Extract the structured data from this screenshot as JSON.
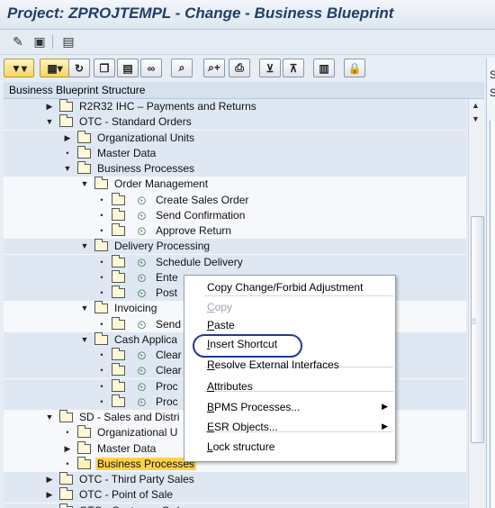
{
  "window": {
    "title": "Project: ZPROJTEMPL - Change - Business Blueprint"
  },
  "toolbar1": [
    {
      "icon": "pencil-glasses-icon",
      "glyph": "✎"
    },
    {
      "icon": "display-other-icon",
      "glyph": "▣"
    },
    {
      "icon": "grid-icon",
      "glyph": "▤"
    }
  ],
  "toolbar2": [
    {
      "icon": "filter-dropdown-icon",
      "glyph": "▼▾"
    },
    {
      "icon": "table-dropdown-icon",
      "glyph": "▦▾"
    },
    {
      "icon": "refresh-icon",
      "glyph": "↻"
    },
    {
      "icon": "copy-icon",
      "glyph": "❐"
    },
    {
      "icon": "paste-icon",
      "glyph": "▤"
    },
    {
      "icon": "link-icon",
      "glyph": "∞"
    },
    {
      "icon": "find-icon",
      "glyph": "⌕"
    },
    {
      "icon": "find-next-icon",
      "glyph": "⌕+"
    },
    {
      "icon": "print-icon",
      "glyph": "⎙"
    },
    {
      "icon": "collapse-icon",
      "glyph": "⊻"
    },
    {
      "icon": "expand-icon",
      "glyph": "⊼"
    },
    {
      "icon": "details-icon",
      "glyph": "▥"
    },
    {
      "icon": "lock-icon",
      "glyph": "🔒"
    }
  ],
  "tree": {
    "header": "Business Blueprint Structure",
    "rows": [
      {
        "label": "R2R32 IHC – Payments and Returns",
        "level": 2,
        "expander": "collapsed",
        "icon": "folder",
        "band": true
      },
      {
        "label": "OTC - Standard Orders",
        "level": 2,
        "expander": "expanded",
        "icon": "folder",
        "band": true
      },
      {
        "label": "Organizational Units",
        "level": 3,
        "expander": "collapsed",
        "icon": "folder",
        "band": true
      },
      {
        "label": "Master Data",
        "level": 3,
        "expander": "leaf",
        "icon": "folder",
        "band": true
      },
      {
        "label": "Business Processes",
        "level": 3,
        "expander": "expanded",
        "icon": "folder",
        "band": true
      },
      {
        "label": "Order Management",
        "level": 4,
        "expander": "expanded",
        "icon": "folder",
        "band": false
      },
      {
        "label": "Create Sales Order",
        "level": 5,
        "expander": "leaf",
        "icon": "process",
        "band": false
      },
      {
        "label": "Send Confirmation",
        "level": 5,
        "expander": "leaf",
        "icon": "process",
        "band": false
      },
      {
        "label": "Approve Return",
        "level": 5,
        "expander": "leaf",
        "icon": "process",
        "band": false
      },
      {
        "label": "Delivery Processing",
        "level": 4,
        "expander": "expanded",
        "icon": "folder",
        "band": true
      },
      {
        "label": "Schedule Delivery",
        "level": 5,
        "expander": "leaf",
        "icon": "process",
        "band": true
      },
      {
        "label": "Ente",
        "level": 5,
        "expander": "leaf",
        "icon": "process",
        "band": true
      },
      {
        "label": "Post",
        "level": 5,
        "expander": "leaf",
        "icon": "process",
        "band": true
      },
      {
        "label": "Invoicing",
        "level": 4,
        "expander": "expanded",
        "icon": "folder",
        "band": false
      },
      {
        "label": "Send",
        "level": 5,
        "expander": "leaf",
        "icon": "process",
        "band": false
      },
      {
        "label": "Cash Applica",
        "level": 4,
        "expander": "expanded",
        "icon": "folder",
        "band": true
      },
      {
        "label": "Clear",
        "level": 5,
        "expander": "leaf",
        "icon": "process",
        "band": true
      },
      {
        "label": "Clear",
        "level": 5,
        "expander": "leaf",
        "icon": "process",
        "band": true
      },
      {
        "label": "Proc",
        "level": 5,
        "expander": "leaf",
        "icon": "process",
        "band": true
      },
      {
        "label": "Proc",
        "level": 5,
        "expander": "leaf",
        "icon": "process",
        "band": true
      },
      {
        "label": "SD - Sales and Distri",
        "level": 2,
        "expander": "expanded",
        "icon": "folder",
        "band": false
      },
      {
        "label": "Organizational U",
        "level": 3,
        "expander": "leaf",
        "icon": "folder",
        "band": false
      },
      {
        "label": "Master Data",
        "level": 3,
        "expander": "collapsed",
        "icon": "folder",
        "band": false
      },
      {
        "label": "Business Processes",
        "level": 3,
        "expander": "leaf",
        "icon": "folder-open",
        "band": false,
        "selected": true
      },
      {
        "label": "OTC - Third Party Sales",
        "level": 2,
        "expander": "collapsed",
        "icon": "folder",
        "band": true
      },
      {
        "label": "OTC - Point of Sale",
        "level": 2,
        "expander": "collapsed",
        "icon": "folder",
        "band": true
      },
      {
        "label": "OTC - Customer Order",
        "level": 2,
        "expander": "collapsed",
        "icon": "folder",
        "band": true
      }
    ]
  },
  "context_menu": {
    "items": [
      {
        "name": "copy-change-forbid-adjustment-item",
        "label": "Copy Change/Forbid Adjustment",
        "hotkey": "",
        "rest": "",
        "disabled": false,
        "submenu": false
      },
      {
        "name": "copy-item",
        "label": "",
        "hotkey": "C",
        "rest": "opy",
        "disabled": true,
        "submenu": false
      },
      {
        "name": "paste-item",
        "label": "",
        "hotkey": "P",
        "rest": "aste",
        "disabled": false,
        "submenu": false
      },
      {
        "name": "insert-shortcut-item",
        "label": "",
        "hotkey": "I",
        "rest": "nsert Shortcut",
        "disabled": false,
        "submenu": false
      },
      {
        "name": "resolve-external-interfaces-item",
        "label": "",
        "hotkey": "R",
        "rest": "esolve External Interfaces",
        "disabled": false,
        "submenu": false
      },
      {
        "name": "attributes-item",
        "label": "",
        "hotkey": "A",
        "rest": "ttributes",
        "disabled": false,
        "submenu": false
      },
      {
        "name": "bpms-processes-item",
        "label": "",
        "hotkey": "B",
        "rest": "PMS Processes...",
        "disabled": false,
        "submenu": true
      },
      {
        "name": "esr-objects-item",
        "label": "",
        "hotkey": "E",
        "rest": "SR Objects...",
        "disabled": false,
        "submenu": true
      },
      {
        "name": "lock-structure-item",
        "label": "",
        "hotkey": "L",
        "rest": "ock structure",
        "disabled": false,
        "submenu": false
      }
    ]
  },
  "right_pane": {
    "letters": [
      "S",
      "S"
    ]
  }
}
